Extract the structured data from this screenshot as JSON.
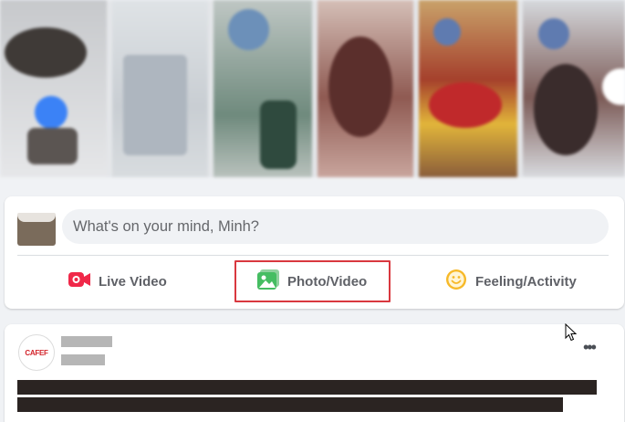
{
  "composer": {
    "placeholder": "What's on your mind, Minh?",
    "actions": [
      {
        "label": "Live Video",
        "icon": "live-video-icon",
        "color": "#f02849"
      },
      {
        "label": "Photo/Video",
        "icon": "photo-video-icon",
        "color": "#45bd62"
      },
      {
        "label": "Feeling/Activity",
        "icon": "feeling-activity-icon",
        "color": "#f7b928"
      }
    ],
    "highlighted_action": "Photo/Video",
    "highlight_color": "#d9383f"
  },
  "post": {
    "page_avatar_text": "CAFEF",
    "more_icon": "more-options-icon"
  },
  "colors": {
    "background": "#f0f2f5",
    "card": "#ffffff",
    "text_secondary": "#65676b"
  }
}
